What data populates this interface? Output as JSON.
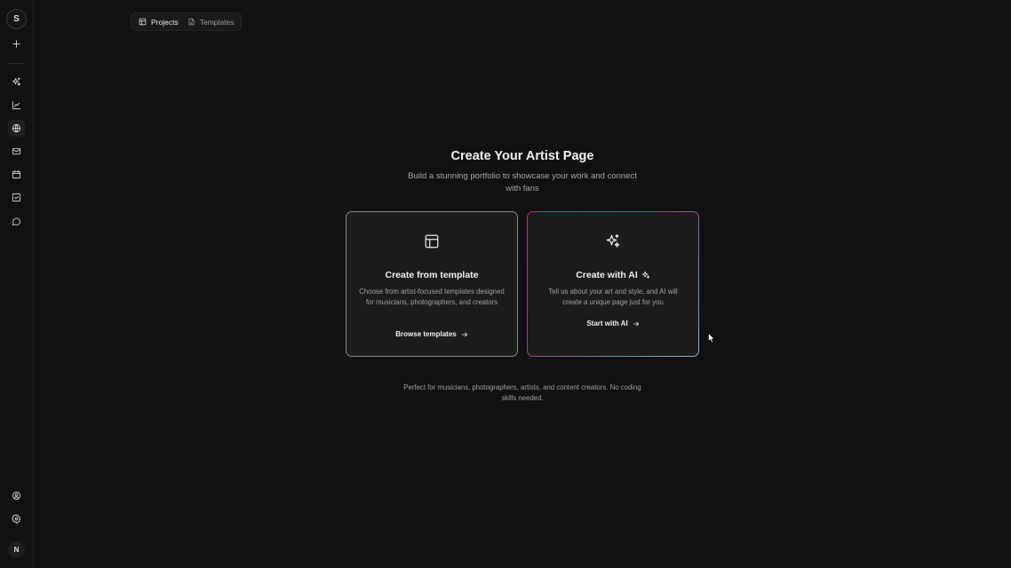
{
  "sidebar": {
    "workspace_initial": "S",
    "user_initial": "N"
  },
  "tabs": [
    {
      "label": "Projects",
      "icon": "layout-icon",
      "active": true
    },
    {
      "label": "Templates",
      "icon": "file-icon",
      "active": false
    }
  ],
  "main": {
    "title": "Create Your Artist Page",
    "subtitle": "Build a stunning portfolio to showcase your work and connect with fans",
    "footnote": "Perfect for musicians, photographers, artists, and content creators. No coding skills needed."
  },
  "cards": {
    "template": {
      "title": "Create from template",
      "description": "Choose from artist-focused templates designed for musicians, photographers, and creators",
      "action": "Browse templates"
    },
    "ai": {
      "title": "Create with AI",
      "description": "Tell us about your art and style, and AI will create a unique page just for you",
      "action": "Start with AI"
    }
  },
  "colors": {
    "background": "#111111",
    "card_bg": "#1c1c1c",
    "ai_gradient_start": "#c0267a",
    "ai_gradient_end": "#88b8d8"
  }
}
